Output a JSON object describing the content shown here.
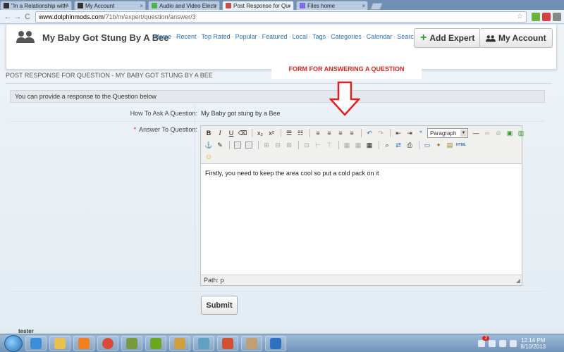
{
  "browser": {
    "tabs": [
      {
        "title": "\"In a Relationship with\" :-",
        "active": false,
        "color": "#333333"
      },
      {
        "title": "My Account",
        "active": false,
        "color": "#333333"
      },
      {
        "title": "Audio and Video Electron",
        "active": false,
        "color": "#4caf50"
      },
      {
        "title": "Post Response for Questio",
        "active": true,
        "color": "#c0504d"
      },
      {
        "title": "Files home",
        "active": false,
        "color": "#7b68ee"
      }
    ],
    "url_host": "www.dolphinmods.com",
    "url_path": "/71b/m/expert/question/answer/3"
  },
  "header": {
    "site_title": "My Baby Got Stung By A Bee",
    "nav": [
      "Home",
      "Recent",
      "Top Rated",
      "Popular",
      "Featured",
      "Local",
      "Tags",
      "Categories",
      "Calendar",
      "Search"
    ],
    "add_expert_label": "Add Expert",
    "my_account_label": "My Account"
  },
  "main": {
    "section_title": "POST RESPONSE FOR QUESTION - MY BABY GOT STUNG BY A BEE",
    "info_text": "You can provide a response to the Question below",
    "question_label": "How To Ask A Question:",
    "question_value": "My Baby got stung by a Bee",
    "answer_label": "Answer To Question:",
    "required_marker": "*",
    "editor": {
      "format_selected": "Paragraph",
      "content": "Firstly, you need to keep the area cool so put a cold pack on it",
      "path_text": "Path: p"
    },
    "submit_label": "Submit"
  },
  "annotation": {
    "text": "FORM FOR ANSWERING A QUESTION",
    "color": "#e02020"
  },
  "footer": {
    "user": "tester"
  },
  "taskbar": {
    "time": "12:14 PM",
    "date": "8/10/2013",
    "notification_count": "2"
  }
}
